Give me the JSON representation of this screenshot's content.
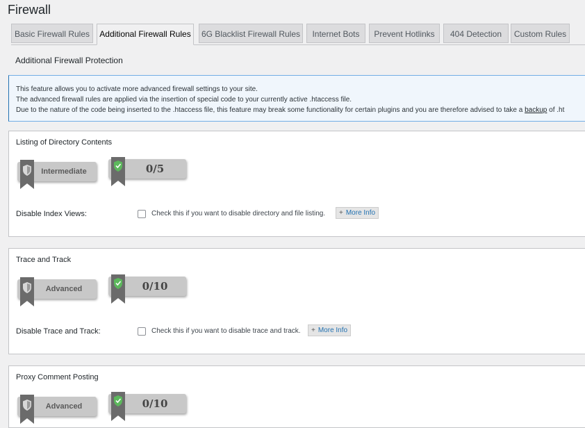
{
  "page": {
    "title": "Firewall"
  },
  "tabs": [
    {
      "label": "Basic Firewall Rules"
    },
    {
      "label": "Additional Firewall Rules"
    },
    {
      "label": "6G Blacklist Firewall Rules"
    },
    {
      "label": "Internet Bots"
    },
    {
      "label": "Prevent Hotlinks"
    },
    {
      "label": "404 Detection"
    },
    {
      "label": "Custom Rules"
    }
  ],
  "active_tab": "Additional Firewall Rules",
  "section": {
    "title": "Additional Firewall Protection"
  },
  "notice": {
    "line1": "This feature allows you to activate more advanced firewall settings to your site.",
    "line2": "The advanced firewall rules are applied via the insertion of special code to your currently active .htaccess file.",
    "line3_before": "Due to the nature of the code being inserted to the .htaccess file, this feature may break some functionality for certain plugins and you are therefore advised to take a ",
    "line3_link": "backup",
    "line3_after": " of .ht"
  },
  "boxes": [
    {
      "title": "Listing of Directory Contents",
      "level": "Intermediate",
      "score": "0/5",
      "option_label": "Disable Index Views:",
      "checked": false,
      "option_desc": "Check this if you want to disable directory and file listing.",
      "more_info": "More Info"
    },
    {
      "title": "Trace and Track",
      "level": "Advanced",
      "score": "0/10",
      "option_label": "Disable Trace and Track:",
      "checked": false,
      "option_desc": "Check this if you want to disable trace and track.",
      "more_info": "More Info"
    },
    {
      "title": "Proxy Comment Posting",
      "level": "Advanced",
      "score": "0/10"
    }
  ],
  "colors": {
    "ribbon_gray": "#6b6b6b",
    "shield_green": "#5cb85c",
    "notice_border": "#72aee6"
  },
  "icons": {
    "level": "shield-icon",
    "score": "shield-check-icon",
    "plus": "plus-icon"
  }
}
